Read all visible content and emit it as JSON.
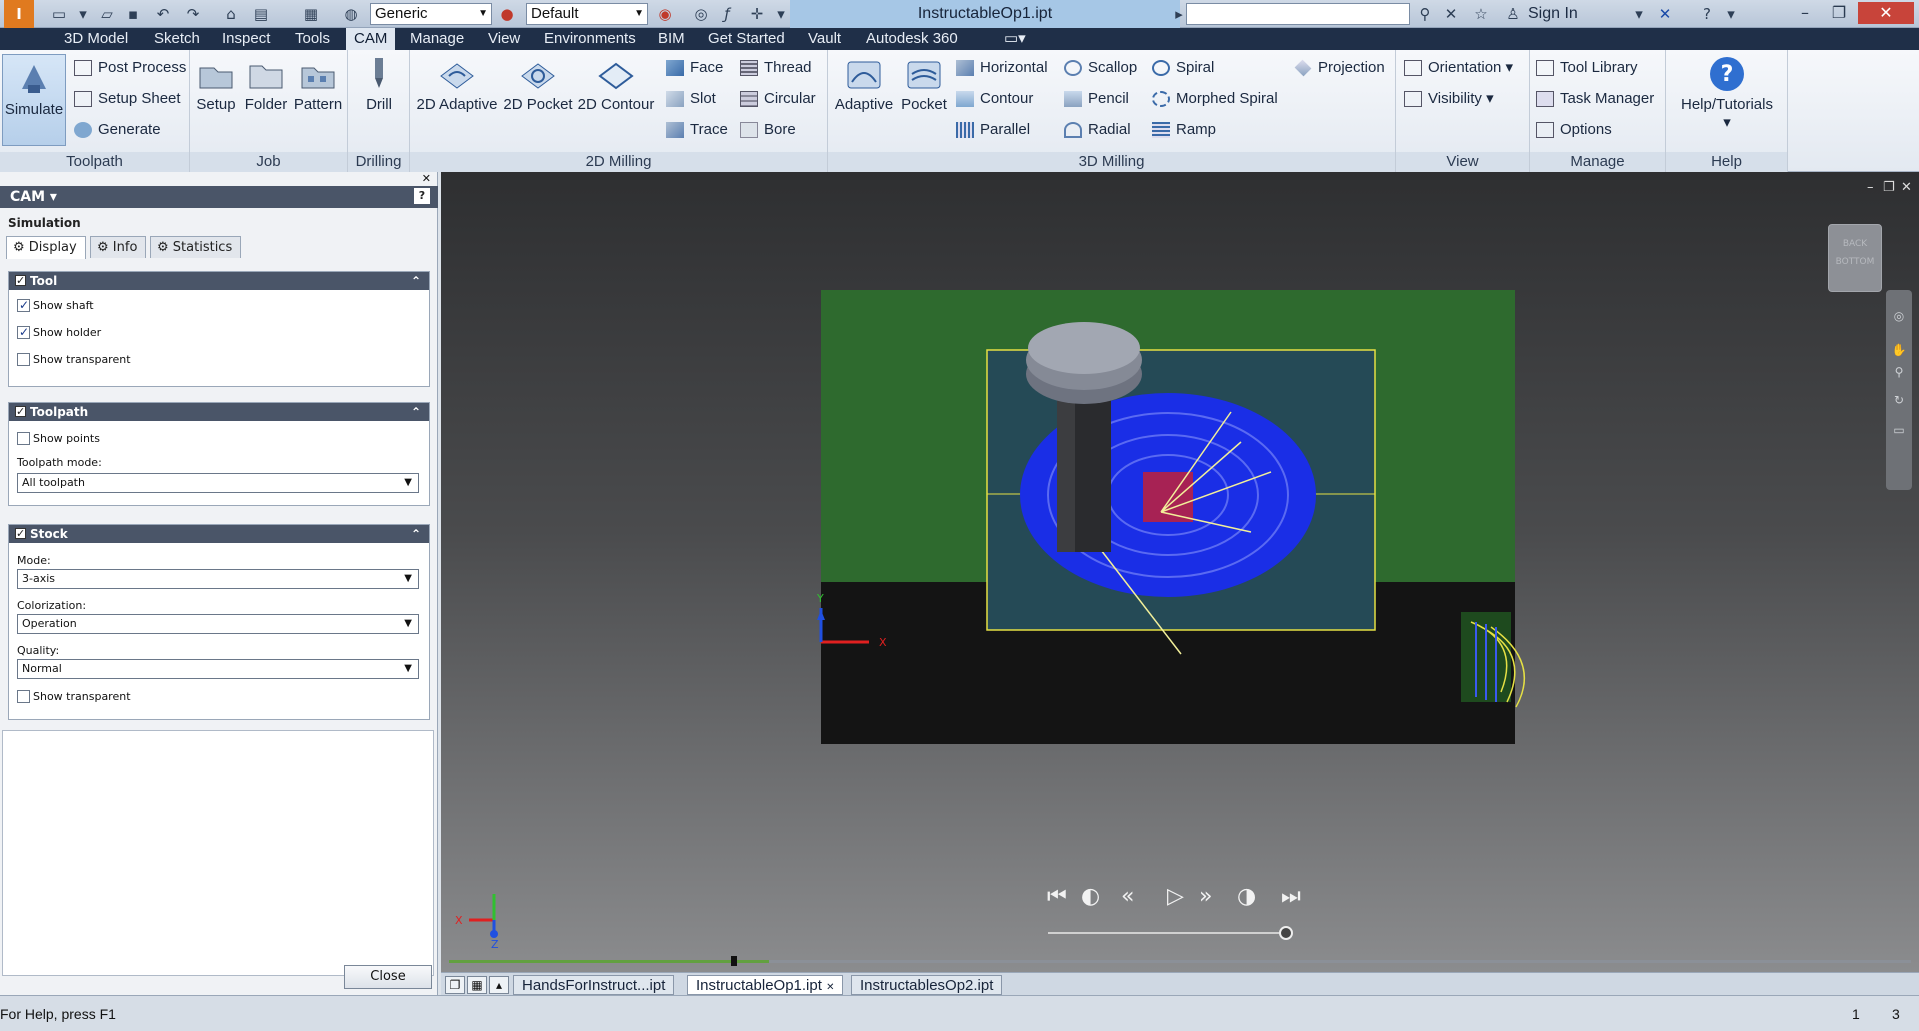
{
  "titlebar": {
    "style_combo": "Generic",
    "appearance_combo": "Default",
    "doc_title": "InstructableOp1.ipt",
    "sign_in": "Sign In"
  },
  "menu": [
    "3D Model",
    "Sketch",
    "Inspect",
    "Tools",
    "CAM",
    "Manage",
    "View",
    "Environments",
    "BIM",
    "Get Started",
    "Vault",
    "Autodesk 360"
  ],
  "menu_active": "CAM",
  "ribbon": {
    "toolpath": {
      "label": "Toolpath",
      "simulate": "Simulate",
      "post_process": "Post Process",
      "setup_sheet": "Setup Sheet",
      "generate": "Generate"
    },
    "job": {
      "label": "Job",
      "setup": "Setup",
      "folder": "Folder",
      "pattern": "Pattern"
    },
    "drilling": {
      "label": "Drilling",
      "drill": "Drill"
    },
    "milling2d": {
      "label": "2D Milling",
      "adaptive": "2D Adaptive",
      "pocket": "2D Pocket",
      "contour": "2D Contour",
      "face": "Face",
      "slot": "Slot",
      "trace": "Trace",
      "thread": "Thread",
      "circular": "Circular",
      "bore": "Bore"
    },
    "milling3d": {
      "label": "3D Milling",
      "adaptive": "Adaptive",
      "pocket": "Pocket",
      "horizontal": "Horizontal",
      "contour": "Contour",
      "parallel": "Parallel",
      "scallop": "Scallop",
      "pencil": "Pencil",
      "radial": "Radial",
      "spiral": "Spiral",
      "morphed_spiral": "Morphed Spiral",
      "ramp": "Ramp",
      "projection": "Projection"
    },
    "view": {
      "label": "View",
      "orientation": "Orientation",
      "visibility": "Visibility"
    },
    "manage": {
      "label": "Manage",
      "tool_library": "Tool Library",
      "task_manager": "Task Manager",
      "options": "Options"
    },
    "help": {
      "label": "Help",
      "tutorials": "Help/Tutorials"
    }
  },
  "leftpanel": {
    "header": "CAM",
    "subtitle": "Simulation",
    "tabs": [
      "Display",
      "Info",
      "Statistics"
    ],
    "tool": {
      "title": "Tool",
      "show_shaft": "Show shaft",
      "show_holder": "Show holder",
      "show_transparent": "Show transparent"
    },
    "toolpath": {
      "title": "Toolpath",
      "show_points": "Show points",
      "mode_label": "Toolpath mode:",
      "mode_value": "All toolpath"
    },
    "stock": {
      "title": "Stock",
      "mode_label": "Mode:",
      "mode_value": "3-axis",
      "colorization_label": "Colorization:",
      "colorization_value": "Operation",
      "quality_label": "Quality:",
      "quality_value": "Normal",
      "show_transparent": "Show transparent"
    },
    "close": "Close"
  },
  "viewport": {
    "viewcube_top": "BACK",
    "viewcube_bottom": "BOTTOM",
    "axis_x": "X",
    "axis_y": "Y",
    "axis_z": "Z"
  },
  "doctabs": [
    "HandsForInstruct...ipt",
    "InstructableOp1.ipt",
    "InstructablesOp2.ipt"
  ],
  "doctab_active": 1,
  "status": {
    "help": "For Help, press F1",
    "num1": "1",
    "num2": "3"
  },
  "colors": {
    "accent": "#1f2f48",
    "stock_green": "#2e6a2e",
    "toolpath_blue": "#1a2ee6"
  }
}
